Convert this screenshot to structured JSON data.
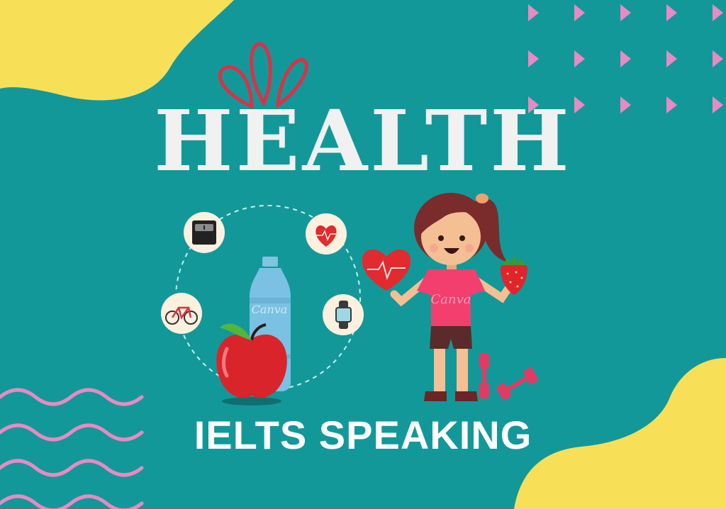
{
  "poster": {
    "title": "HEALTH",
    "subtitle": "IELTS SPEAKING",
    "watermark": "Canva"
  },
  "colors": {
    "background": "#13989a",
    "blob": "#f7e058",
    "title": "#f1f1f1",
    "accent_pink": "#e98ac0",
    "shirt": "#f23f6e",
    "apple": "#d9242b"
  },
  "icons": [
    "scale-icon",
    "heart-rate-icon",
    "bicycle-icon",
    "smartwatch-icon",
    "water-bottle-icon",
    "apple-icon",
    "heart-icon",
    "strawberry-icon",
    "dumbbell-icon"
  ]
}
